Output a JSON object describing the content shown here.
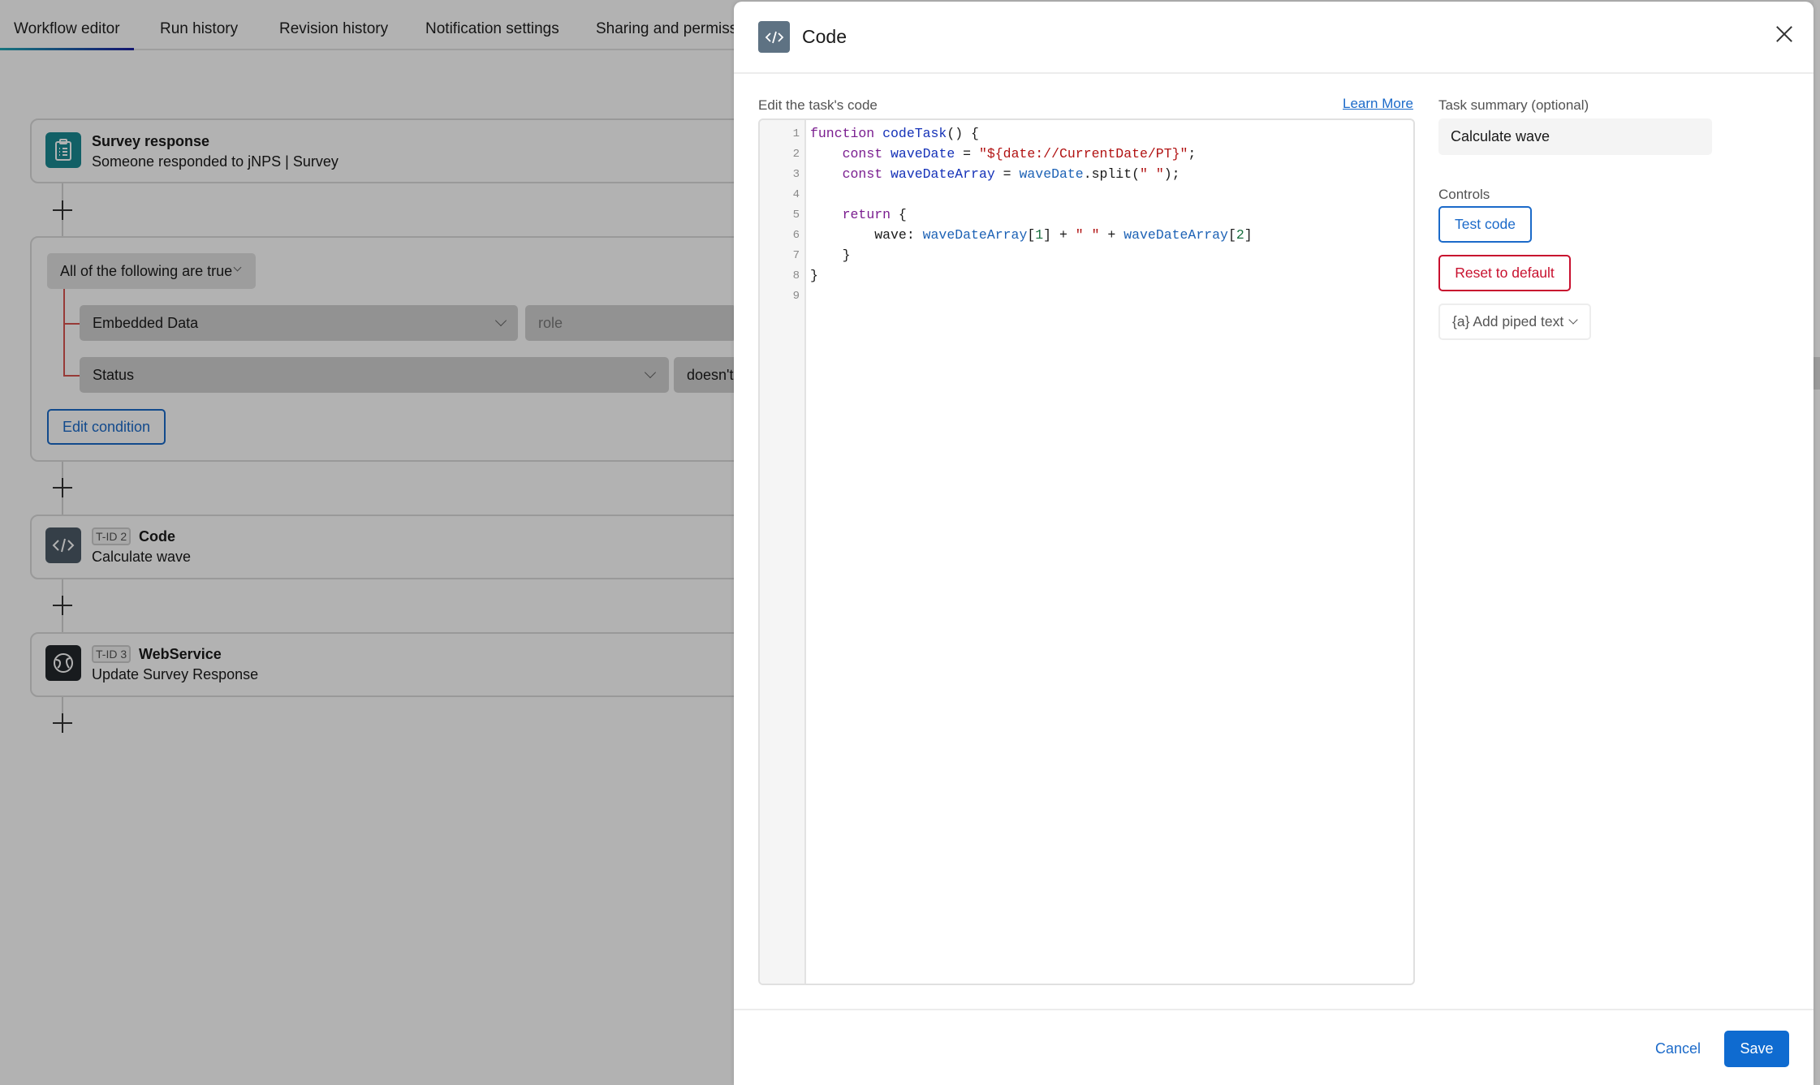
{
  "tabs": [
    {
      "label": "Workflow editor",
      "active": true
    },
    {
      "label": "Run history"
    },
    {
      "label": "Revision history"
    },
    {
      "label": "Notification settings"
    },
    {
      "label": "Sharing and permissio"
    }
  ],
  "workflow": {
    "trigger": {
      "title": "Survey response",
      "subtitle": "Someone responded to jNPS | Survey",
      "icon": "clipboard-icon",
      "color": "#1b8a93"
    },
    "condition": {
      "group_label": "All of the following are true",
      "rows": [
        {
          "field": "Embedded Data",
          "value_placeholder": "role"
        },
        {
          "field": "Status",
          "operator": "doesn't"
        }
      ],
      "edit_label": "Edit condition"
    },
    "tasks": [
      {
        "tid": "T-ID 2",
        "title": "Code",
        "subtitle": "Calculate wave",
        "icon": "code-icon",
        "color": "#4d5b68"
      },
      {
        "tid": "T-ID 3",
        "title": "WebService",
        "subtitle": "Update Survey Response",
        "icon": "globe-icon",
        "color": "#23272b"
      }
    ]
  },
  "modal": {
    "title": "Code",
    "icon": "code-icon",
    "editor_label": "Edit the task's code",
    "learn_more": "Learn More",
    "code_lines": [
      "function codeTask() {",
      "    const waveDate = \"${date://CurrentDate/PT}\";",
      "    const waveDateArray = waveDate.split(\" \");",
      "",
      "    return {",
      "        wave: waveDateArray[1] + \" \" + waveDateArray[2]",
      "    }",
      "}",
      ""
    ],
    "line_numbers": [
      "1",
      "2",
      "3",
      "4",
      "5",
      "6",
      "7",
      "8",
      "9"
    ],
    "summary_label": "Task summary (optional)",
    "summary_value": "Calculate wave",
    "controls_label": "Controls",
    "test_code": "Test code",
    "reset": "Reset to default",
    "piped_text": "{a} Add piped text",
    "cancel": "Cancel",
    "save": "Save"
  },
  "colors": {
    "primary": "#0f6bd0",
    "danger": "#c8102e",
    "code_icon_bg": "#5e7283"
  }
}
